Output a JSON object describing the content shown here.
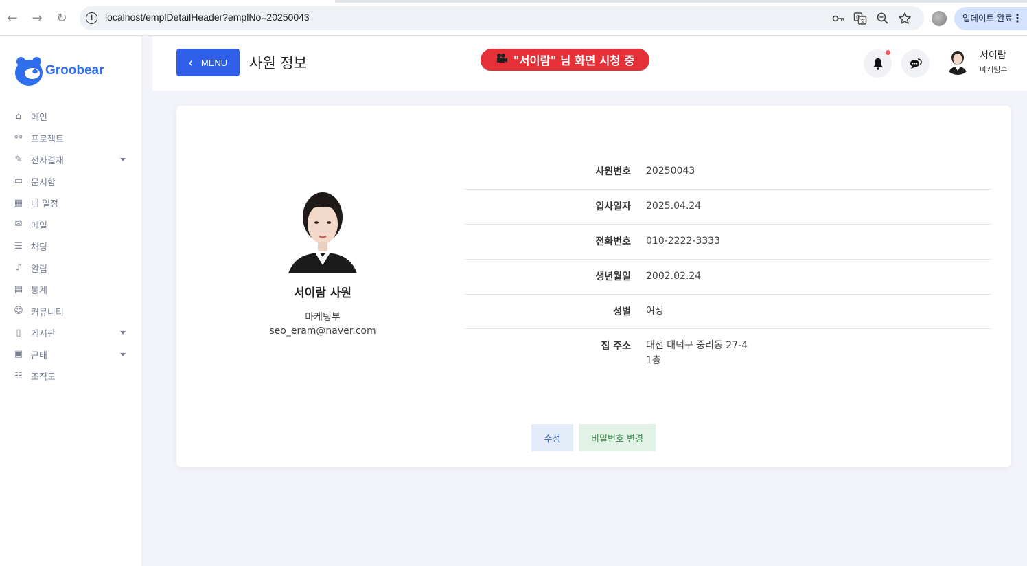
{
  "browser": {
    "url": "localhost/emplDetailHeader?emplNo=20250043",
    "update_label": "업데이트 완료",
    "back_icon": "←",
    "forward_icon": "→",
    "reload_icon": "↻",
    "more_icon": "⋮"
  },
  "sidebar": {
    "brand": "Groobear",
    "items": [
      {
        "label": "메인",
        "icon": "⌂",
        "icon_name": "home-icon",
        "has_caret": false
      },
      {
        "label": "프로젝트",
        "icon": "⚯",
        "icon_name": "project-icon",
        "has_caret": false
      },
      {
        "label": "전자결재",
        "icon": "✎",
        "icon_name": "approval-icon",
        "has_caret": true
      },
      {
        "label": "문서함",
        "icon": "▭",
        "icon_name": "folder-icon",
        "has_caret": false
      },
      {
        "label": "내 일정",
        "icon": "▦",
        "icon_name": "calendar-icon",
        "has_caret": false
      },
      {
        "label": "메일",
        "icon": "✉",
        "icon_name": "mail-icon",
        "has_caret": false
      },
      {
        "label": "채팅",
        "icon": "☰",
        "icon_name": "chat-icon",
        "has_caret": false
      },
      {
        "label": "알림",
        "icon": "♪",
        "icon_name": "bell-icon",
        "has_caret": false
      },
      {
        "label": "통계",
        "icon": "▤",
        "icon_name": "stats-icon",
        "has_caret": false
      },
      {
        "label": "커뮤니티",
        "icon": "☺",
        "icon_name": "community-icon",
        "has_caret": false
      },
      {
        "label": "게시판",
        "icon": "▯",
        "icon_name": "board-icon",
        "has_caret": true
      },
      {
        "label": "근태",
        "icon": "▣",
        "icon_name": "attendance-icon",
        "has_caret": true
      },
      {
        "label": "조직도",
        "icon": "☷",
        "icon_name": "org-chart-icon",
        "has_caret": false
      }
    ]
  },
  "header": {
    "menu_label": "MENU",
    "menu_icon": "‹",
    "title": "사원 정보",
    "watch_banner": "\"서이람\" 님 화면 시청 중",
    "user_name": "서이람",
    "user_dept": "마케팅부"
  },
  "profile": {
    "name": "서이람 사원",
    "dept": "마케팅부",
    "email": "seo_eram@naver.com"
  },
  "details": [
    {
      "label": "사원번호",
      "value": "20250043"
    },
    {
      "label": "입사일자",
      "value": "2025.04.24"
    },
    {
      "label": "전화번호",
      "value": "010-2222-3333"
    },
    {
      "label": "생년월일",
      "value": "2002.02.24"
    },
    {
      "label": "성별",
      "value": "여성"
    },
    {
      "label": "집 주소",
      "value": "대전 대덕구 중리동 27-4",
      "value2": "1층"
    }
  ],
  "actions": {
    "edit_label": "수정",
    "password_label": "비밀번호 변경"
  },
  "colors": {
    "primary": "#2f5fe8",
    "brand": "#2f6fee",
    "banner": "#e53038",
    "edit_bg": "#e3ecf8",
    "password_bg": "#e3f2e6"
  }
}
